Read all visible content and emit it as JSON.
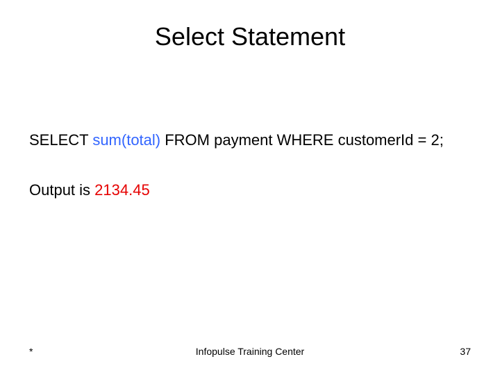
{
  "title": "Select Statement",
  "sql": {
    "select": "SELECT ",
    "aggregate": "sum(total)",
    "rest": " FROM payment WHERE customerId = 2;"
  },
  "output": {
    "label": "Output is ",
    "value": "2134.45"
  },
  "footer": {
    "left": "*",
    "center": "Infopulse Training Center",
    "page": "37"
  }
}
